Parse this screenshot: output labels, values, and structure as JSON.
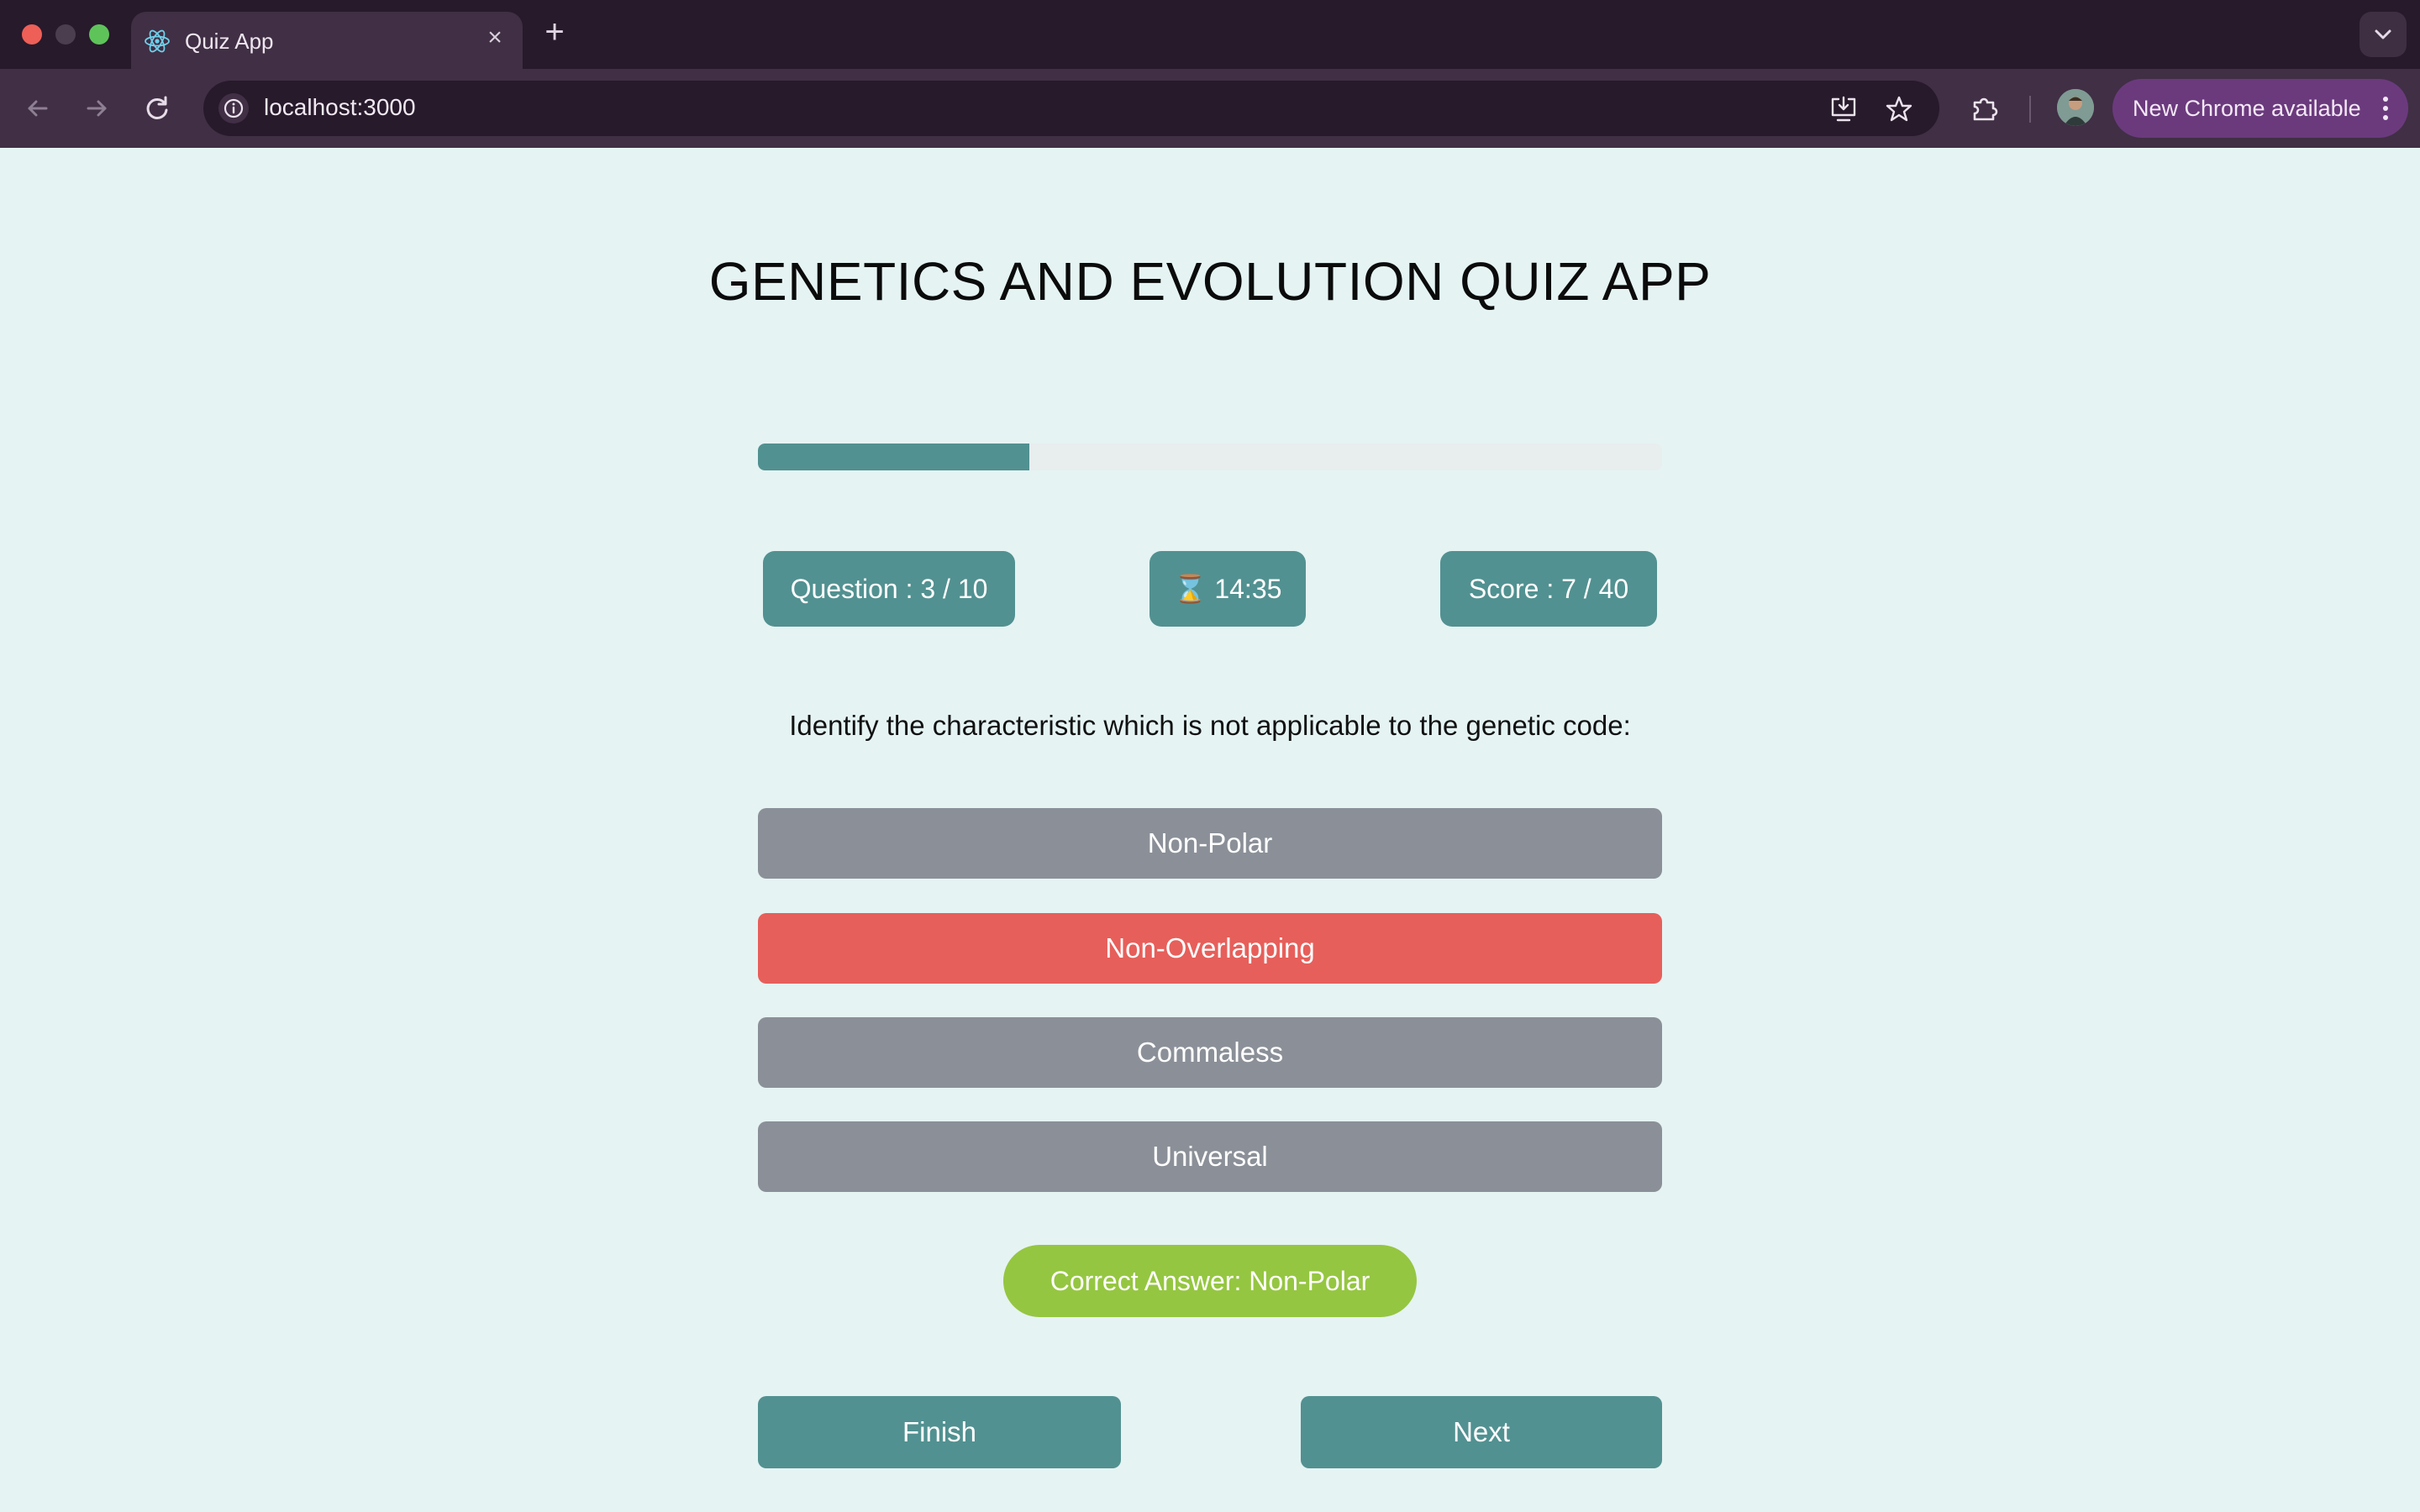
{
  "browser": {
    "tab_title": "Quiz App",
    "url": "localhost:3000",
    "update_label": "New Chrome available"
  },
  "app": {
    "title": "GENETICS AND EVOLUTION QUIZ APP",
    "progress": 0.3,
    "question_counter": "Question : 3 / 10",
    "timer": "⌛ 14:35",
    "score": "Score : 7 / 40",
    "question": "Identify the characteristic which is not applicable to the genetic code:",
    "options": [
      {
        "label": "Non-Polar",
        "state": "neutral"
      },
      {
        "label": "Non-Overlapping",
        "state": "wrong"
      },
      {
        "label": "Commaless",
        "state": "neutral"
      },
      {
        "label": "Universal",
        "state": "neutral"
      }
    ],
    "correct_answer": "Correct Answer: Non-Polar",
    "finish_label": "Finish",
    "next_label": "Next"
  },
  "colors": {
    "accent": "#529191",
    "wrong": "#e75f5a",
    "neutral_option": "#8b9098",
    "correct": "#95c641",
    "page_bg": "#e5f3f3"
  }
}
